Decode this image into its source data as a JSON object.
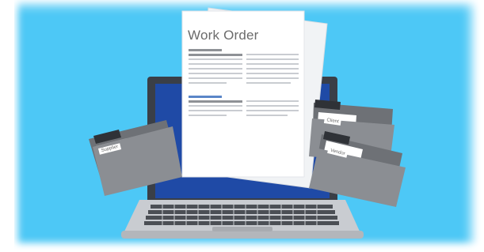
{
  "document": {
    "title": "Work Order"
  },
  "folders": {
    "left_label": "Supplier",
    "right_top_label": "Client",
    "right_bottom_label": "Vendor"
  },
  "colors": {
    "background": "#4dc8f6",
    "screen": "#1f4aa6",
    "laptop_frame": "#3a3f47",
    "keyboard_base": "#c9ccd1",
    "folder_gray": "#8b8e93",
    "paper": "#ffffff",
    "accent_blue_line": "#5b86c8"
  },
  "icons": [
    "laptop-icon",
    "document-icon",
    "folder-icon"
  ]
}
